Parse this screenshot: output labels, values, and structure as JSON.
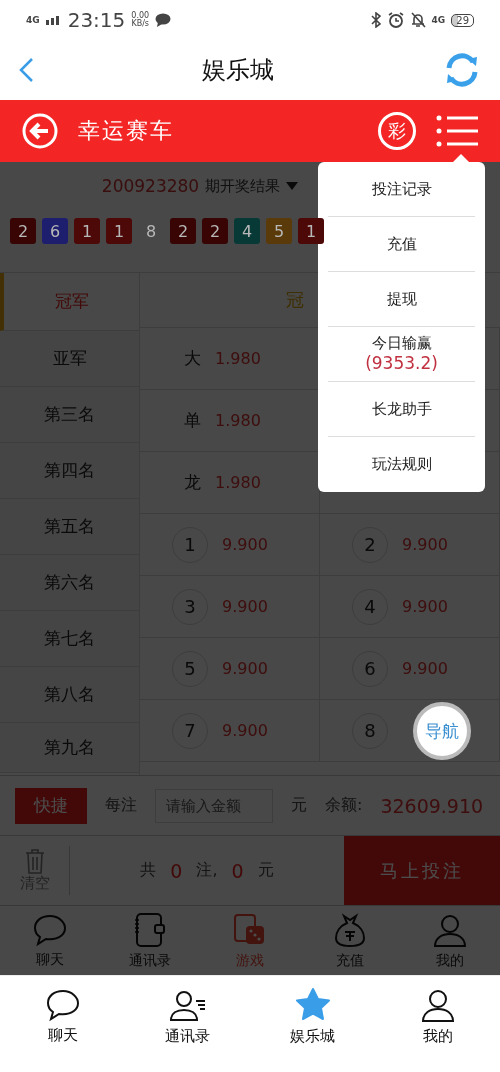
{
  "status_bar": {
    "network": "4G",
    "time": "23:15",
    "speed": "0.00",
    "speed_unit": "KB/s",
    "network_right": "4G",
    "battery": "29"
  },
  "header": {
    "title": "娱乐城"
  },
  "game_bar": {
    "title": "幸运赛车",
    "badge": "彩"
  },
  "draw": {
    "issue": "200923280",
    "label": "期开奖结果",
    "balls": [
      {
        "number": "2",
        "color": "#380404"
      },
      {
        "number": "6",
        "color": "#1e1e6e"
      },
      {
        "number": "1",
        "color": "#4d0808"
      },
      {
        "number": "1",
        "color": "#4d0808"
      },
      {
        "number": "8",
        "color": "#484848"
      },
      {
        "number": "2",
        "color": "#380404"
      },
      {
        "number": "2",
        "color": "#380404"
      },
      {
        "number": "4",
        "color": "#073a37"
      },
      {
        "number": "5",
        "color": "#5a3a08"
      },
      {
        "number": "1",
        "color": "#4d0808"
      }
    ]
  },
  "positions": [
    {
      "label": "冠军",
      "selected": true
    },
    {
      "label": "亚军",
      "selected": false
    },
    {
      "label": "第三名",
      "selected": false
    },
    {
      "label": "第四名",
      "selected": false
    },
    {
      "label": "第五名",
      "selected": false
    },
    {
      "label": "第六名",
      "selected": false
    },
    {
      "label": "第七名",
      "selected": false
    },
    {
      "label": "第八名",
      "selected": false
    },
    {
      "label": "第九名",
      "selected": false
    }
  ],
  "bet_header": "冠",
  "bet_rows": [
    [
      {
        "kind": "text",
        "label": "大",
        "odds": "1.980"
      }
    ],
    [
      {
        "kind": "text",
        "label": "单",
        "odds": "1.980"
      }
    ],
    [
      {
        "kind": "text",
        "label": "龙",
        "odds": "1.980"
      }
    ],
    [
      {
        "kind": "ball",
        "label": "1",
        "odds": "9.900"
      },
      {
        "kind": "ball",
        "label": "2",
        "odds": "9.900"
      }
    ],
    [
      {
        "kind": "ball",
        "label": "3",
        "odds": "9.900"
      },
      {
        "kind": "ball",
        "label": "4",
        "odds": "9.900"
      }
    ],
    [
      {
        "kind": "ball",
        "label": "5",
        "odds": "9.900"
      },
      {
        "kind": "ball",
        "label": "6",
        "odds": "9.900"
      }
    ],
    [
      {
        "kind": "ball",
        "label": "7",
        "odds": "9.900"
      },
      {
        "kind": "ball",
        "label": "8"
      }
    ]
  ],
  "bet_bar": {
    "quick": "快捷",
    "per": "每注",
    "placeholder": "请输入金额",
    "unit": "元",
    "balance_label": "余额:",
    "balance": "32609.910"
  },
  "summary": {
    "clear": "清空",
    "prefix": "共",
    "count": "0",
    "mid": "注,",
    "amount": "0",
    "suffix": "元",
    "submit": "马上投注"
  },
  "app_tabs": [
    {
      "label": "聊天",
      "selected": false
    },
    {
      "label": "通讯录",
      "selected": false
    },
    {
      "label": "游戏",
      "selected": true
    },
    {
      "label": "充值",
      "selected": false
    },
    {
      "label": "我的",
      "selected": false
    }
  ],
  "menu": [
    {
      "label": "投注记录"
    },
    {
      "label": "充值"
    },
    {
      "label": "提现"
    },
    {
      "label": "今日输赢",
      "value": "(9353.2)"
    },
    {
      "label": "长龙助手"
    },
    {
      "label": "玩法规则"
    }
  ],
  "float_button": "导航",
  "nav_tabs": [
    {
      "label": "聊天",
      "selected": false
    },
    {
      "label": "通讯录",
      "selected": false
    },
    {
      "label": "娱乐城",
      "selected": true
    },
    {
      "label": "我的",
      "selected": false
    }
  ]
}
